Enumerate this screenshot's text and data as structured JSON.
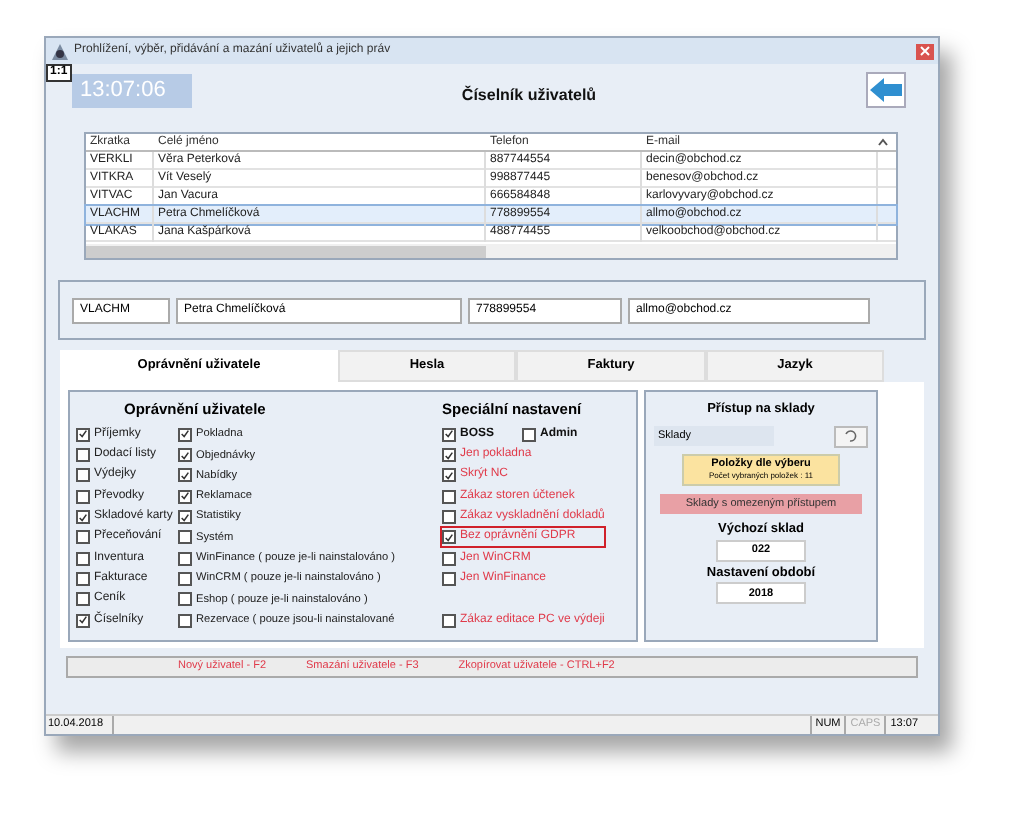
{
  "window": {
    "title": "Prohlížení, výběr, přidávání a mazání uživatelů a jejich práv",
    "zoom_badge": "1:1",
    "clock": "13:07:06",
    "heading": "Číselník uživatelů"
  },
  "table": {
    "columns": [
      "Zkratka",
      "Celé jméno",
      "Telefon",
      "E-mail"
    ],
    "rows": [
      {
        "cells": [
          "VERKLI",
          "Věra Peterková",
          "887744554",
          "decin@obchod.cz"
        ],
        "selected": false
      },
      {
        "cells": [
          "VITKRA",
          "Vít Veselý",
          "998877445",
          "benesov@obchod.cz"
        ],
        "selected": false
      },
      {
        "cells": [
          "VITVAC",
          "Jan Vacura",
          "666584848",
          "karlovyvary@obchod.cz"
        ],
        "selected": false
      },
      {
        "cells": [
          "VLACHM",
          "Petra Chmelíčková",
          "778899554",
          "allmo@obchod.cz"
        ],
        "selected": true
      },
      {
        "cells": [
          "VLAKAS",
          "Jana Kašpárková",
          "488774455",
          "velkoobchod@obchod.cz"
        ],
        "selected": false
      }
    ]
  },
  "editor": {
    "fields": [
      "VLACHM",
      "Petra Chmelíčková",
      "778899554",
      "allmo@obchod.cz"
    ]
  },
  "tabs": [
    {
      "label": "Oprávnění uživatele",
      "selected": true
    },
    {
      "label": "Hesla",
      "selected": false
    },
    {
      "label": "Faktury",
      "selected": false
    },
    {
      "label": "Jazyk",
      "selected": false
    }
  ],
  "permissions": {
    "title": "Oprávnění uživatele",
    "special_title": "Speciální nastavení",
    "rows": [
      {
        "left": {
          "label": "Příjemky",
          "checked": true
        },
        "middle": {
          "label": "Pokladna",
          "checked": true
        },
        "special": [
          {
            "label": "BOSS",
            "checked": true,
            "kind": "plain",
            "highlighted": false
          },
          {
            "label": "Admin",
            "checked": false,
            "kind": "plain",
            "highlighted": false
          }
        ]
      },
      {
        "left": {
          "label": "Dodací listy",
          "checked": false
        },
        "middle": {
          "label": "Objednávky",
          "checked": true
        },
        "special": [
          {
            "label": "Jen pokladna",
            "checked": true,
            "kind": "restriction",
            "highlighted": false
          }
        ]
      },
      {
        "left": {
          "label": "Výdejky",
          "checked": false
        },
        "middle": {
          "label": "Nabídky",
          "checked": true
        },
        "special": [
          {
            "label": "Skrýt NC",
            "checked": true,
            "kind": "restriction",
            "highlighted": false
          }
        ]
      },
      {
        "left": {
          "label": "Převodky",
          "checked": false
        },
        "middle": {
          "label": "Reklamace",
          "checked": true
        },
        "special": [
          {
            "label": "Zákaz storen účtenek",
            "checked": false,
            "kind": "restriction",
            "highlighted": false
          }
        ]
      },
      {
        "left": {
          "label": "Skladové karty",
          "checked": true
        },
        "middle": {
          "label": "Statistiky",
          "checked": true
        },
        "special": [
          {
            "label": "Zákaz vyskladnění dokladů",
            "checked": false,
            "kind": "restriction",
            "highlighted": false
          }
        ]
      },
      {
        "left": {
          "label": "Přeceňování",
          "checked": false
        },
        "middle": {
          "label": "Systém",
          "checked": false
        },
        "special": [
          {
            "label": "Bez oprávnění GDPR",
            "checked": true,
            "kind": "restriction",
            "highlighted": true
          }
        ]
      },
      {
        "left": {
          "label": "Inventura",
          "checked": false
        },
        "middle": {
          "label": "WinFinance ( pouze je-li nainstalováno )",
          "checked": false
        },
        "special": [
          {
            "label": "Jen WinCRM",
            "checked": false,
            "kind": "restriction",
            "highlighted": false
          }
        ]
      },
      {
        "left": {
          "label": "Fakturace",
          "checked": false
        },
        "middle": {
          "label": "WinCRM ( pouze je-li nainstalováno )",
          "checked": false
        },
        "special": [
          {
            "label": "Jen WinFinance",
            "checked": false,
            "kind": "restriction",
            "highlighted": false
          }
        ]
      },
      {
        "left": {
          "label": "Ceník",
          "checked": false
        },
        "middle": {
          "label": "Eshop ( pouze je-li nainstalováno )",
          "checked": false
        },
        "special": []
      },
      {
        "left": {
          "label": "Číselníky",
          "checked": true
        },
        "middle": {
          "label": "Rezervace ( pouze jsou-li nainstalované",
          "checked": false
        },
        "special": [
          {
            "label": "Zákaz editace PC ve výdeji",
            "checked": false,
            "kind": "restriction",
            "highlighted": false
          }
        ]
      }
    ]
  },
  "warehouse": {
    "title": "Přístup na sklady",
    "field": "Sklady",
    "selection_button": {
      "title": "Položky dle výberu",
      "subtitle": "Počet vybraných položek : 11"
    },
    "restricted_button": "Sklady s omezeným přístupem",
    "default_label": "Výchozí sklad",
    "default_value": "022",
    "period_label": "Nastavení období",
    "period_value": "2018"
  },
  "actions": [
    "Nový uživatel - F2",
    "Smazání uživatele - F3",
    "Zkopírovat uživatele - CTRL+F2"
  ],
  "status_bar": {
    "date": "10.04.2018",
    "num": "NUM",
    "caps": "CAPS",
    "caps_on": false,
    "time": "13:07"
  }
}
